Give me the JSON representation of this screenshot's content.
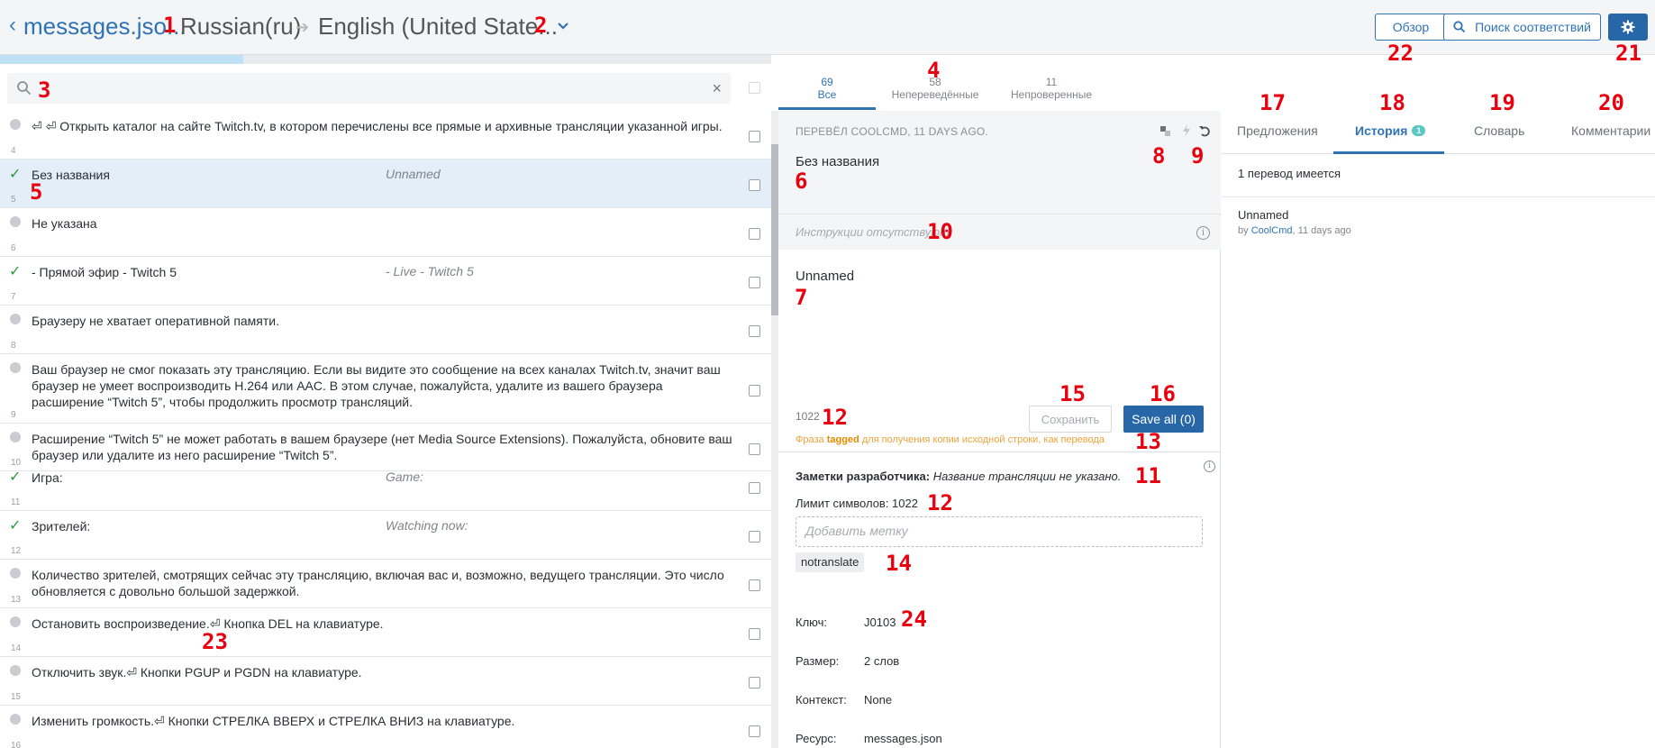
{
  "header": {
    "file_name": "messages.jso...",
    "source_language": "Russian(ru)",
    "target_language": "English (United State...",
    "overview_label": "Обзор",
    "match_search_label": "Поиск соответствий"
  },
  "search": {
    "placeholder": ""
  },
  "filter_tabs": [
    {
      "count": "69",
      "label": "Все"
    },
    {
      "count": "58",
      "label": "Непереведённые"
    },
    {
      "count": "11",
      "label": "Непроверенные"
    }
  ],
  "strings": [
    {
      "num": "4",
      "status": "pending",
      "source": "⏎ ⏎ Открыть каталог на сайте Twitch.tv, в котором перечислены все прямые и архивные трансляции указанной игры.",
      "translation": ""
    },
    {
      "num": "5",
      "status": "done",
      "source": "Без названия",
      "translation": "Unnamed"
    },
    {
      "num": "6",
      "status": "pending",
      "source": "Не указана",
      "translation": ""
    },
    {
      "num": "7",
      "status": "done",
      "source": "- Прямой эфир - Twitch 5",
      "translation": "- Live - Twitch 5"
    },
    {
      "num": "8",
      "status": "pending",
      "source": "Браузеру не хватает оперативной памяти.",
      "translation": ""
    },
    {
      "num": "9",
      "status": "pending",
      "source": "Ваш браузер не смог показать эту трансляцию. Если вы видите это сообщение на всех каналах Twitch.tv, значит ваш браузер не умеет воспроизводить H.264 или AAC. В этом случае, пожалуйста, удалите из вашего браузера расширение “Twitch 5”, чтобы продолжить просмотр трансляций.",
      "translation": ""
    },
    {
      "num": "10",
      "status": "pending",
      "source": "Расширение “Twitch 5” не может работать в вашем браузере (нет Media Source Extensions). Пожалуйста, обновите ваш браузер или удалите из него расширение “Twitch 5”.",
      "translation": ""
    },
    {
      "num": "11",
      "status": "done",
      "source": "Игра:",
      "translation": "Game:"
    },
    {
      "num": "12",
      "status": "done",
      "source": "Зрителей:",
      "translation": "Watching now:"
    },
    {
      "num": "13",
      "status": "pending",
      "source": "Количество зрителей, смотрящих сейчас эту трансляцию, включая вас и, возможно, ведущего трансляции. Это число обновляется с довольно большой задержкой.",
      "translation": ""
    },
    {
      "num": "14",
      "status": "pending",
      "source": "Остановить воспроизведение.⏎ Кнопка DEL на клавиатуре.",
      "translation": ""
    },
    {
      "num": "15",
      "status": "pending",
      "source": "Отключить звук.⏎ Кнопки PGUP и PGDN на клавиатуре.",
      "translation": ""
    },
    {
      "num": "16",
      "status": "pending",
      "source": "Изменить громкость.⏎ Кнопки СТРЕЛКА ВВЕРХ и СТРЕЛКА ВНИЗ на клавиатуре.",
      "translation": ""
    }
  ],
  "editor": {
    "translated_by": "ПЕРЕВЁЛ COOLCMD, 11 DAYS AGO.",
    "source_text": "Без названия",
    "instructions": "Инструкции отсутствуют.",
    "translation": "Unnamed",
    "char_count": "1022",
    "save_label": "Сохранить",
    "save_all_label": "Save all (0)",
    "hint_prefix": "Фраза ",
    "hint_bold": "tagged",
    "hint_suffix": " для получения копии исходной строки, как перевода",
    "dev_notes_label": "Заметки разработчика:",
    "dev_notes_text": "Название трансляции не указано.",
    "limit_label": "Лимит символов: 1022",
    "tag_placeholder": "Добавить метку",
    "tag": "notranslate",
    "meta": [
      {
        "key": "Ключ:",
        "value": "J0103"
      },
      {
        "key": "Размер:",
        "value": "2 слов"
      },
      {
        "key": "Контекст:",
        "value": "None"
      },
      {
        "key": "Ресурс:",
        "value": "messages.json"
      }
    ]
  },
  "right_tabs": {
    "suggestions": "Предложения",
    "history": "История",
    "history_badge": "1",
    "glossary": "Словарь",
    "comments": "Комментарии"
  },
  "history": {
    "count_text": "1 перевод имеется",
    "entry_text": "Unnamed",
    "entry_by_prefix": "by ",
    "entry_user": "CoolCmd",
    "entry_time": ", 11 days ago"
  },
  "markers": [
    "1",
    "2",
    "3",
    "4",
    "5",
    "6",
    "7",
    "8",
    "9",
    "10",
    "11",
    "12",
    "12",
    "13",
    "14",
    "15",
    "16",
    "17",
    "18",
    "19",
    "20",
    "21",
    "22",
    "23",
    "24"
  ],
  "colors": {
    "accent": "#2767a8",
    "done": "#2c9b3d",
    "marker": "#e8000f"
  }
}
